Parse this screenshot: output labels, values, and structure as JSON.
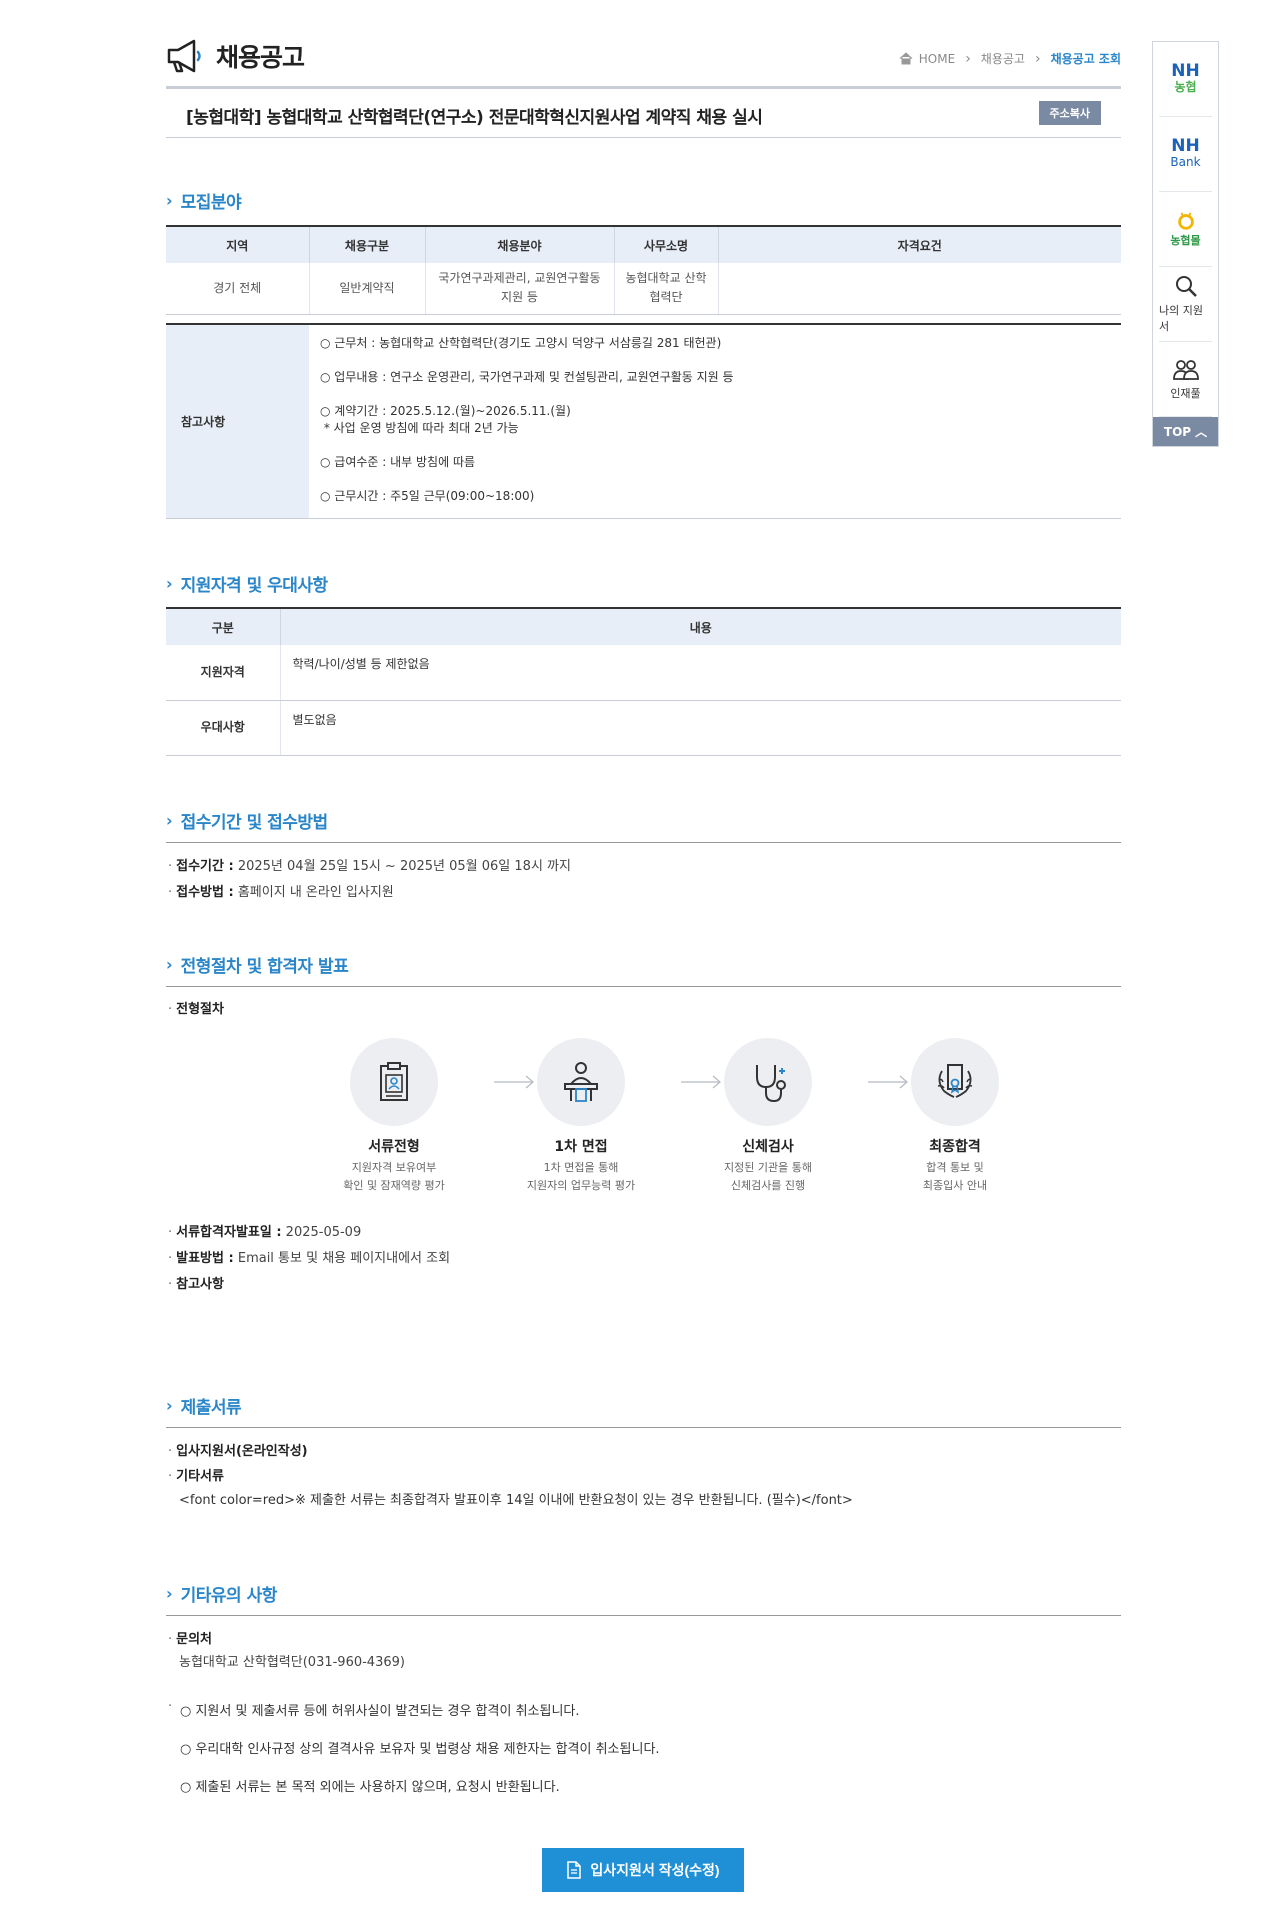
{
  "header": {
    "page_title": "채용공고",
    "breadcrumb": [
      "HOME",
      "채용공고",
      "채용공고 조회"
    ]
  },
  "job": {
    "title": "[농협대학] 농협대학교 산학협력단(연구소) 전문대학혁신지원사업 계약직 채용 실시",
    "copy_button": "주소복사"
  },
  "recruit": {
    "heading": "모집분야",
    "columns": [
      "지역",
      "채용구분",
      "채용분야",
      "사무소명",
      "자격요건"
    ],
    "row": [
      "경기 전체",
      "일반계약직",
      "국가연구과제관리, 교원연구활동 지원 등",
      "농협대학교 산학협력단",
      ""
    ]
  },
  "reference": {
    "label": "참고사항",
    "lines": [
      "○ 근무처 : 농협대학교 산학협력단(경기도 고양시 덕양구 서삼릉길 281 태헌관)",
      "○ 업무내용 : 연구소 운영관리, 국가연구과제 및 컨설팅관리, 교원연구활동 지원 등",
      "○ 계약기간 : 2025.5.12.(월)~2026.5.11.(월)",
      " * 사업 운영 방침에 따라 최대 2년 가능",
      "○ 급여수준 : 내부 방침에 따름",
      "○ 근무시간 : 주5일 근무(09:00~18:00)"
    ]
  },
  "qualification": {
    "heading": "지원자격 및 우대사항",
    "columns": [
      "구분",
      "내용"
    ],
    "rows": [
      {
        "k": "지원자격",
        "v": "학력/나이/성별 등 제한없음"
      },
      {
        "k": "우대사항",
        "v": "별도없음"
      }
    ]
  },
  "reception": {
    "heading": "접수기간 및 접수방법",
    "period_label": "접수기간 :",
    "period_value": " 2025년 04월 25일 15시 ~ 2025년 05월 06일 18시 까지",
    "method_label": "접수방법 :",
    "method_value": " 홈페이지 내 온라인 입사지원"
  },
  "selection": {
    "heading": "전형절차 및 합격자 발표",
    "process_label": "전형절차",
    "steps": [
      {
        "name": "서류전형",
        "desc1": "지원자격 보유여부",
        "desc2": "확인 및 잠재역량 평가"
      },
      {
        "name": "1차 면접",
        "desc1": "1차 면접을 통해",
        "desc2": "지원자의 업무능력 평가"
      },
      {
        "name": "신체검사",
        "desc1": "지정된 기관을 통해",
        "desc2": "신체검사를 진행"
      },
      {
        "name": "최종합격",
        "desc1": "합격 통보 및",
        "desc2": "최종입사 안내"
      }
    ],
    "doc_pass_label": "서류합격자발표일 :",
    "doc_pass_value": " 2025-05-09",
    "announce_label": "발표방법 :",
    "announce_value": " Email 통보 및 채용 페이지내에서 조회",
    "note_label": "참고사항"
  },
  "documents": {
    "heading": "제출서류",
    "item1": "입사지원서(온라인작성)",
    "item2": "기타서류",
    "item2_note": "<font color=red>※ 제출한 서류는 최종합격자 발표이후 14일 이내에 반환요청이 있는 경우 반환됩니다. (필수)</font>"
  },
  "etc": {
    "heading": "기타유의 사항",
    "contact_label": "문의처",
    "contact_value": "농협대학교 산학협력단(031-960-4369)",
    "notices": [
      "○ 지원서 및 제출서류 등에 허위사실이 발견되는 경우 합격이 취소됩니다.",
      "○ 우리대학 인사규정 상의 결격사유 보유자 및 법령상 채용 제한자는 합격이 취소됩니다.",
      "○ 제출된 서류는 본 목적 외에는 사용하지 않으며, 요청시 반환됩니다."
    ]
  },
  "apply_button": "입사지원서 작성(수정)",
  "quick_menu": {
    "nh_top": "NH",
    "nh_nonghyup": "농협",
    "nh_bank_top": "NH",
    "nh_bank": "Bank",
    "nonghyup_mall": "농협몰",
    "my_application": "나의 지원서",
    "talent_pool": "인재풀",
    "top": "TOP"
  },
  "colors": {
    "accent": "#2a86c9",
    "button": "#1f8fd6",
    "table_head": "#e8eef7",
    "copy_button": "#7a8aa3"
  }
}
